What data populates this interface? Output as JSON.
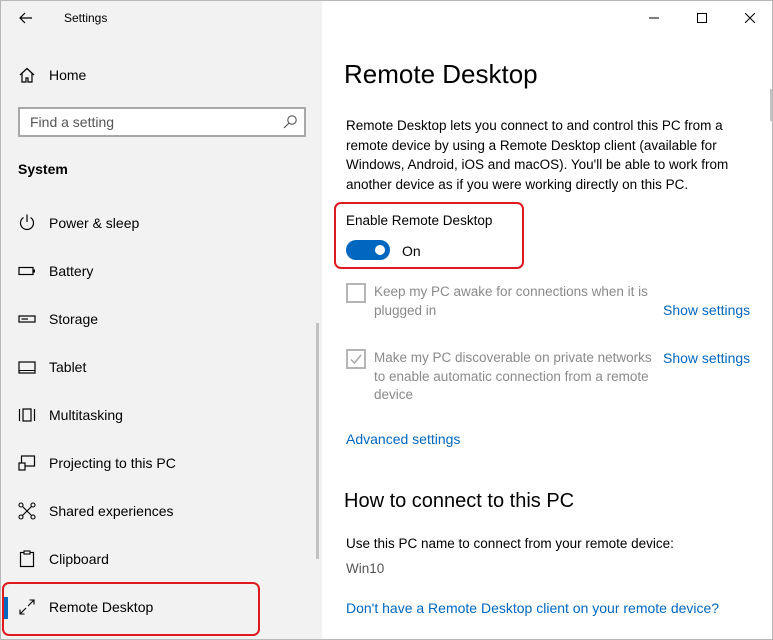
{
  "app": {
    "title": "Settings"
  },
  "sidebar": {
    "home_label": "Home",
    "search_placeholder": "Find a setting",
    "section_label": "System",
    "items": [
      {
        "label": "Power & sleep",
        "icon": "power-icon"
      },
      {
        "label": "Battery",
        "icon": "battery-icon"
      },
      {
        "label": "Storage",
        "icon": "storage-icon"
      },
      {
        "label": "Tablet",
        "icon": "tablet-icon"
      },
      {
        "label": "Multitasking",
        "icon": "multitasking-icon"
      },
      {
        "label": "Projecting to this PC",
        "icon": "projecting-icon"
      },
      {
        "label": "Shared experiences",
        "icon": "shared-experiences-icon"
      },
      {
        "label": "Clipboard",
        "icon": "clipboard-icon"
      },
      {
        "label": "Remote Desktop",
        "icon": "remote-desktop-icon",
        "selected": true
      }
    ]
  },
  "main": {
    "title": "Remote Desktop",
    "description": "Remote Desktop lets you connect to and control this PC from a remote device by using a Remote Desktop client (available for Windows, Android, iOS and macOS). You'll be able to work from another device as if you were working directly on this PC.",
    "enable_label": "Enable Remote Desktop",
    "toggle_state": "On",
    "options": [
      {
        "text": "Keep my PC awake for connections when it is plugged in",
        "checked": false,
        "link": "Show settings"
      },
      {
        "text": "Make my PC discoverable on private networks to enable automatic connection from a remote device",
        "checked": true,
        "link": "Show settings"
      }
    ],
    "advanced_link": "Advanced settings",
    "how_to_title": "How to connect to this PC",
    "use_name_text": "Use this PC name to connect from your remote device:",
    "pc_name": "Win10",
    "client_link": "Don't have a Remote Desktop client on your remote device?"
  },
  "colors": {
    "accent": "#0067c0",
    "highlight": "#e0191f",
    "sidebar_bg": "#f2f2f2"
  }
}
